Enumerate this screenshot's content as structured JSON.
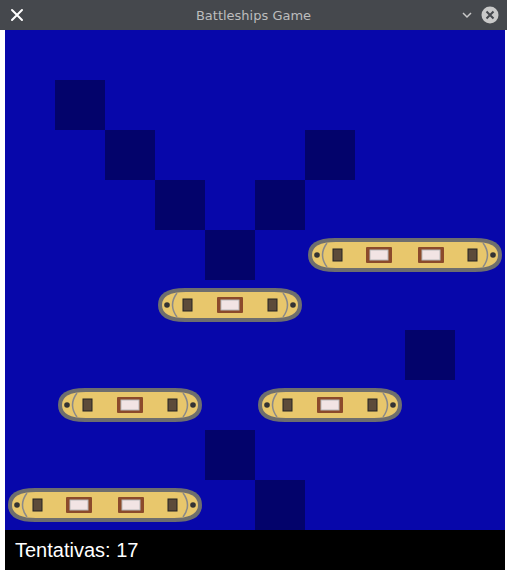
{
  "window": {
    "title": "Battleships Game"
  },
  "board": {
    "columns": 10,
    "rows": 10,
    "misses": [
      {
        "row": 1,
        "col": 1
      },
      {
        "row": 2,
        "col": 2
      },
      {
        "row": 3,
        "col": 3
      },
      {
        "row": 4,
        "col": 4
      },
      {
        "row": 2,
        "col": 6
      },
      {
        "row": 3,
        "col": 5
      },
      {
        "row": 6,
        "col": 8
      },
      {
        "row": 8,
        "col": 4
      },
      {
        "row": 9,
        "col": 5
      }
    ],
    "ships": [
      {
        "row": 4,
        "col": 6,
        "length": 4
      },
      {
        "row": 5,
        "col": 3,
        "length": 3
      },
      {
        "row": 7,
        "col": 1,
        "length": 3
      },
      {
        "row": 7,
        "col": 5,
        "length": 3
      },
      {
        "row": 9,
        "col": 0,
        "length": 4
      }
    ]
  },
  "status_bar": {
    "text": "Tentativas: 17"
  }
}
